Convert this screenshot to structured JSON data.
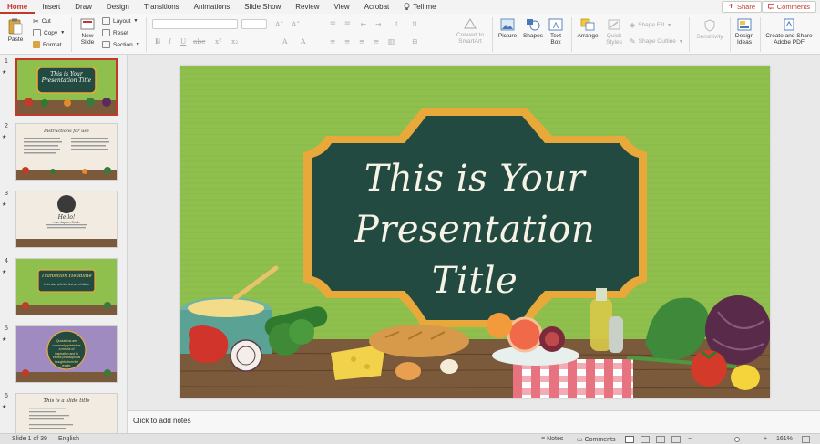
{
  "tabs": [
    "Home",
    "Insert",
    "Draw",
    "Design",
    "Transitions",
    "Animations",
    "Slide Show",
    "Review",
    "View",
    "Acrobat"
  ],
  "tell_me": "Tell me",
  "share_label": "Share",
  "comments_label": "Comments",
  "ribbon": {
    "paste": "Paste",
    "cut": "Cut",
    "copy": "Copy",
    "format": "Format",
    "new_slide_1": "New",
    "new_slide_2": "Slide",
    "layout": "Layout",
    "reset": "Reset",
    "section": "Section",
    "convert_1": "Convert to",
    "convert_2": "SmartArt",
    "picture": "Picture",
    "shapes": "Shapes",
    "textbox_1": "Text",
    "textbox_2": "Box",
    "arrange": "Arrange",
    "quick_styles_1": "Quick",
    "quick_styles_2": "Styles",
    "shape_fill": "Shape Fill",
    "shape_outline": "Shape Outline",
    "sensitivity": "Sensitivity",
    "design_ideas_1": "Design",
    "design_ideas_2": "Ideas",
    "adobe_1": "Create and Share",
    "adobe_2": "Adobe PDF"
  },
  "thumbnails": [
    {
      "num": "1",
      "title": "This is Your Presentation Title",
      "bg": "#8fbf4d"
    },
    {
      "num": "2",
      "title": "Instructions for use",
      "bg": "#f1ebe2"
    },
    {
      "num": "3",
      "title": "Hello!",
      "sub": "I am Jayden Smith",
      "bg": "#f1ebe2"
    },
    {
      "num": "4",
      "title": "Transition Headline",
      "sub": "Let's start with the first set of slides",
      "bg": "#8fbf4d"
    },
    {
      "num": "5",
      "title": "Quotations are commonly printed as a means of inspiration and to invoke philosophical thoughts from the reader.",
      "bg": "#9f8bbf"
    },
    {
      "num": "6",
      "title": "This is a slide title",
      "bg": "#f1ebe2"
    }
  ],
  "slide": {
    "title_line1": "This is Your",
    "title_line2": "Presentation Title"
  },
  "notes_placeholder": "Click to add notes",
  "status": {
    "slide_counter": "Slide 1 of 39",
    "language": "English",
    "notes": "Notes",
    "comments": "Comments",
    "zoom": "161%"
  },
  "colors": {
    "accent": "#c0392b",
    "slide_green": "#8fbf4d",
    "board": "#224a40",
    "frame_gold": "#e8a93a"
  }
}
